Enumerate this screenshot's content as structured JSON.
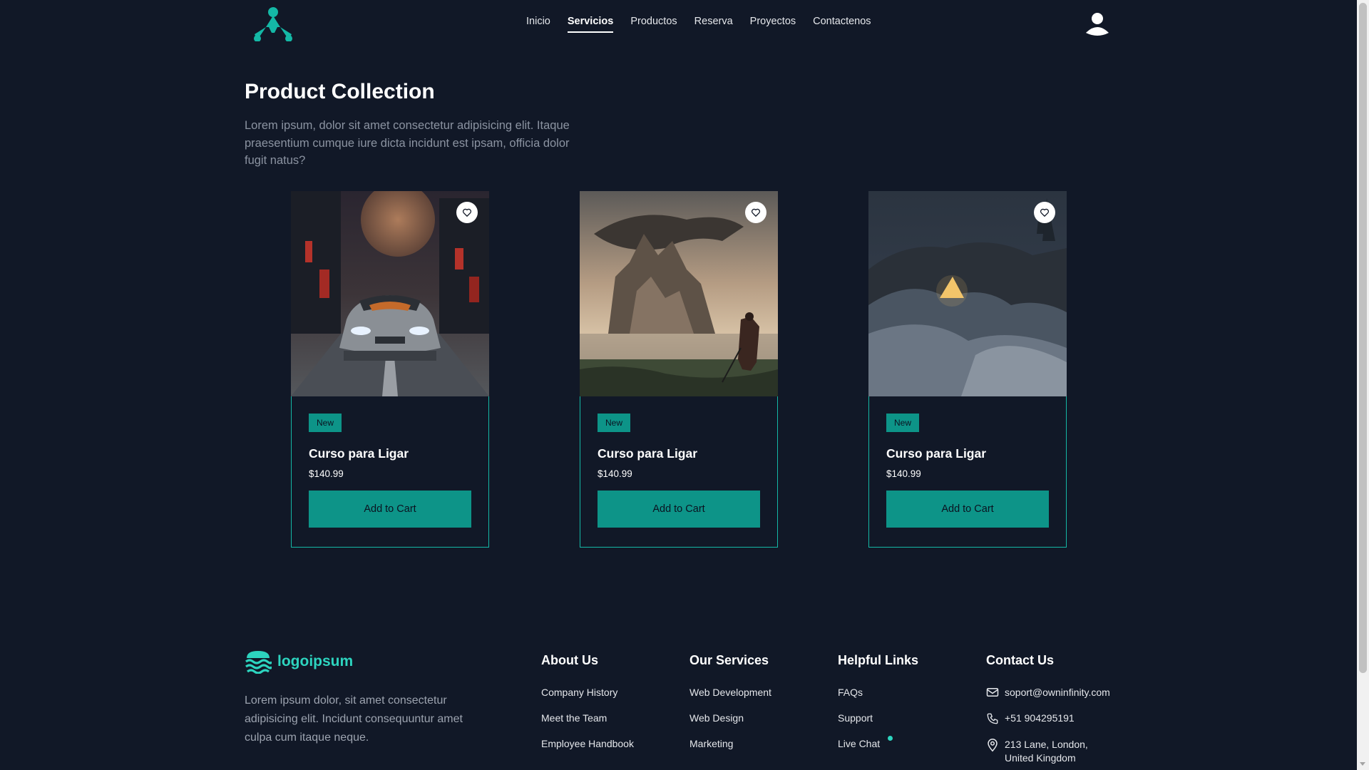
{
  "nav": {
    "items": [
      {
        "label": "Inicio"
      },
      {
        "label": "Servicios",
        "active": true
      },
      {
        "label": "Productos"
      },
      {
        "label": "Reserva"
      },
      {
        "label": "Proyectos"
      },
      {
        "label": "Contactenos"
      }
    ]
  },
  "hero": {
    "title": "Product Collection",
    "description": "Lorem ipsum, dolor sit amet consectetur adipisicing elit. Itaque praesentium cumque iure dicta incidunt est ipsam, officia dolor fugit natus?"
  },
  "products": [
    {
      "badge": "New",
      "title": "Curso para Ligar",
      "price": "$140.99",
      "button": "Add to Cart"
    },
    {
      "badge": "New",
      "title": "Curso para Ligar",
      "price": "$140.99",
      "button": "Add to Cart"
    },
    {
      "badge": "New",
      "title": "Curso para Ligar",
      "price": "$140.99",
      "button": "Add to Cart"
    }
  ],
  "footer": {
    "logo_text": "logoipsum",
    "description": "Lorem ipsum dolor, sit amet consectetur adipisicing elit. Incidunt consequuntur amet culpa cum itaque neque.",
    "columns": [
      {
        "title": "About Us",
        "links": [
          "Company History",
          "Meet the Team",
          "Employee Handbook"
        ]
      },
      {
        "title": "Our Services",
        "links": [
          "Web Development",
          "Web Design",
          "Marketing"
        ]
      },
      {
        "title": "Helpful Links",
        "links": [
          "FAQs",
          "Support",
          "Live Chat"
        ]
      }
    ],
    "contact": {
      "title": "Contact Us",
      "email": "soport@owninfinity.com",
      "phone": "+51 904295191",
      "address": "213 Lane, London, United Kingdom"
    }
  },
  "colors": {
    "background": "#111827",
    "accent": "#0d9488",
    "accent_light": "#2dd4bf",
    "muted_text": "#8b93a1"
  },
  "icons": [
    "brand-logo-icon",
    "user-avatar-icon",
    "heart-icon",
    "waves-logo-icon",
    "mail-icon",
    "phone-icon",
    "map-pin-icon"
  ]
}
